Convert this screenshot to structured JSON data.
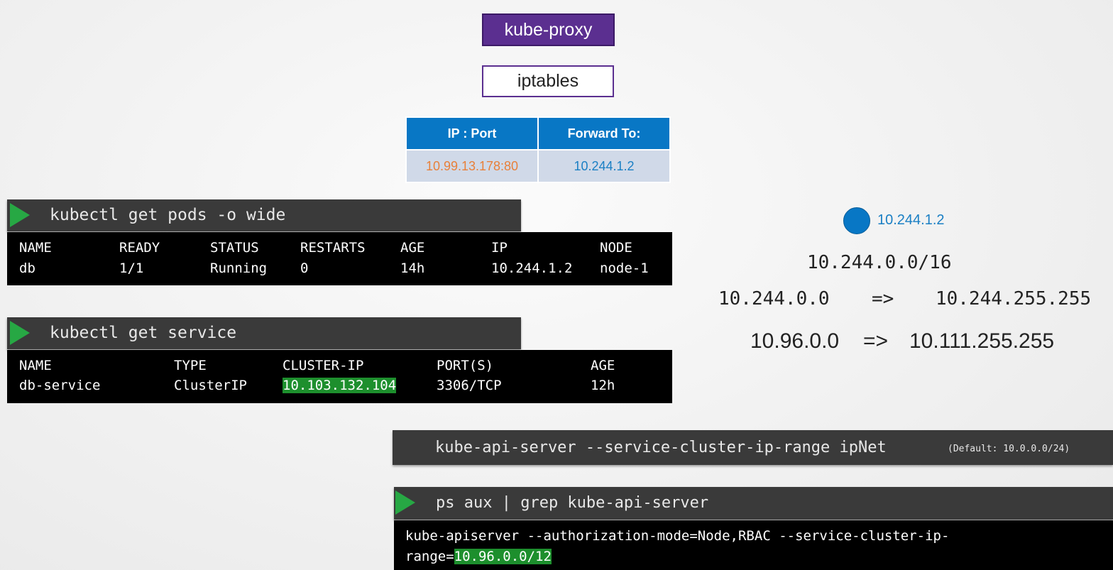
{
  "kube_proxy": {
    "label": "kube-proxy"
  },
  "iptables": {
    "label": "iptables"
  },
  "forward_table": {
    "headers": [
      "IP : Port",
      "Forward To:"
    ],
    "row": [
      "10.99.13.178:80",
      "10.244.1.2"
    ],
    "colors": {
      "header_bg": "#0877c5",
      "ipport_text": "#e8803a",
      "forward_text": "#1a7fc4"
    }
  },
  "pods_terminal": {
    "command": "kubectl get pods -o wide",
    "headers": [
      "NAME",
      "READY",
      "STATUS",
      "RESTARTS",
      "AGE",
      "IP",
      "NODE"
    ],
    "row": [
      "db",
      "1/1",
      "Running",
      "0",
      "14h",
      "10.244.1.2",
      "node-1"
    ]
  },
  "service_terminal": {
    "command": "kubectl get service",
    "headers": [
      "NAME",
      "TYPE",
      "CLUSTER-IP",
      "PORT(S)",
      "AGE"
    ],
    "row": [
      "db-service",
      "ClusterIP",
      "10.103.132.104",
      "3306/TCP",
      "12h"
    ],
    "highlight_color": "#1d8f2d"
  },
  "pod_node": {
    "ip": "10.244.1.2",
    "color": "#0877c5"
  },
  "pod_network": {
    "cidr": "10.244.0.0/16",
    "range_start": "10.244.0.0",
    "arrow": "=>",
    "range_end": "10.244.255.255"
  },
  "service_network": {
    "range_start": "10.96.0.0",
    "arrow": "=>",
    "range_end": "10.111.255.255"
  },
  "apiserver_flag": {
    "command": "kube-api-server --service-cluster-ip-range ipNet",
    "default_note": "(Default: 10.0.0.0/24)"
  },
  "ps_terminal": {
    "command": "ps aux | grep kube-api-server",
    "output_line1": "kube-apiserver --authorization-mode=Node,RBAC --service-cluster-ip-",
    "output_line2_prefix": "range=",
    "output_line2_value": "10.96.0.0/12"
  }
}
